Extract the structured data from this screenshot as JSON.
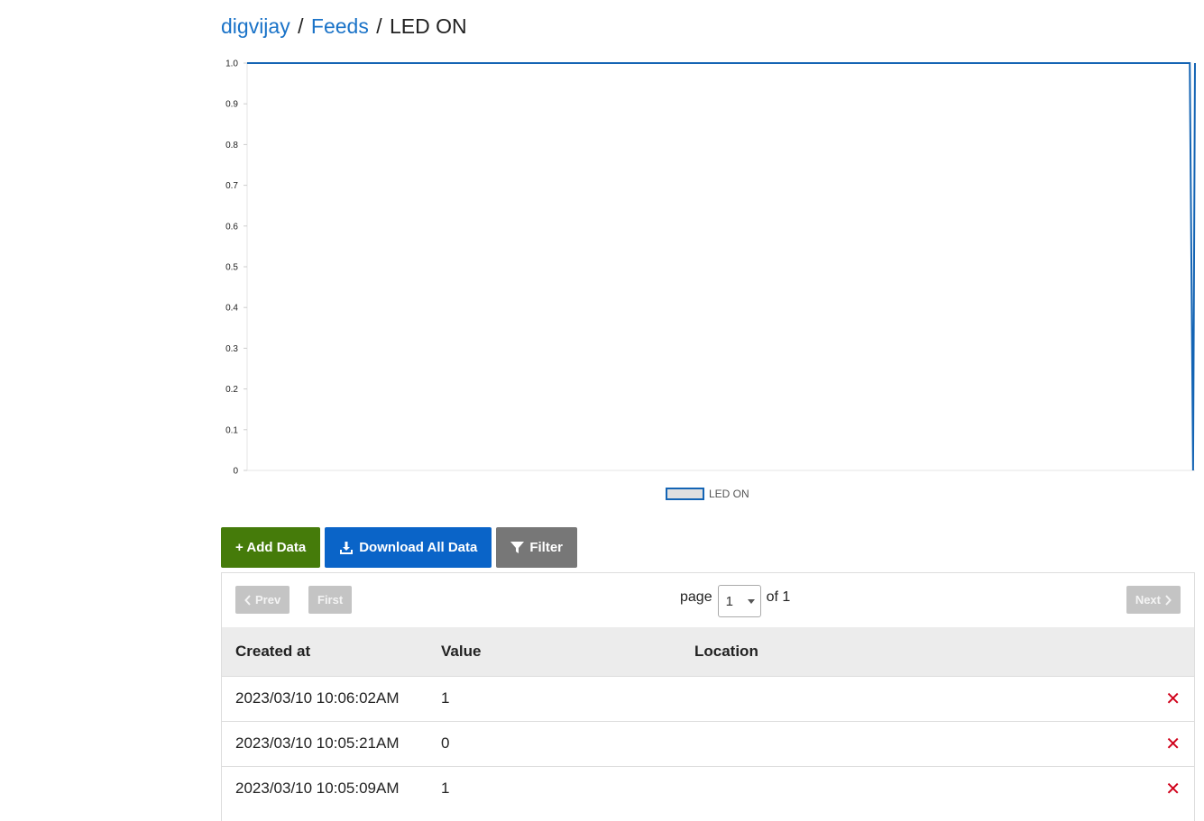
{
  "breadcrumb": {
    "user": "digvijay",
    "feeds": "Feeds",
    "current": "LED ON",
    "separator": "/"
  },
  "chart_data": {
    "type": "line",
    "title": "",
    "xlabel": "",
    "ylabel": "",
    "ylim": [
      0,
      1
    ],
    "yticks": [
      "0",
      "0.1",
      "0.2",
      "0.3",
      "0.4",
      "0.5",
      "0.6",
      "0.7",
      "0.8",
      "0.9",
      "1.0"
    ],
    "series": [
      {
        "name": "LED ON",
        "color": "#1464b4",
        "points": [
          [
            0,
            1
          ],
          [
            0.9945,
            1
          ],
          [
            0.998,
            0
          ],
          [
            1.0,
            1
          ]
        ]
      }
    ],
    "legend": "bottom-center",
    "grid": false
  },
  "actions": {
    "add": "+ Add Data",
    "download": "Download All Data",
    "filter": "Filter"
  },
  "pager": {
    "prev": "Prev",
    "first": "First",
    "page_label": "page",
    "page": "1",
    "of_label": "of 1",
    "next": "Next"
  },
  "table": {
    "headers": [
      "Created at",
      "Value",
      "Location"
    ],
    "rows": [
      {
        "created_at": "2023/03/10 10:06:02AM",
        "value": "1",
        "location": ""
      },
      {
        "created_at": "2023/03/10 10:05:21AM",
        "value": "0",
        "location": ""
      },
      {
        "created_at": "2023/03/10 10:05:09AM",
        "value": "1",
        "location": ""
      }
    ],
    "delete_icon": "✕"
  },
  "colors": {
    "link": "#1a73c8",
    "add_button": "#457b0a",
    "download_button": "#0a64c8",
    "filter_button": "#777777",
    "delete": "#d0021b"
  }
}
